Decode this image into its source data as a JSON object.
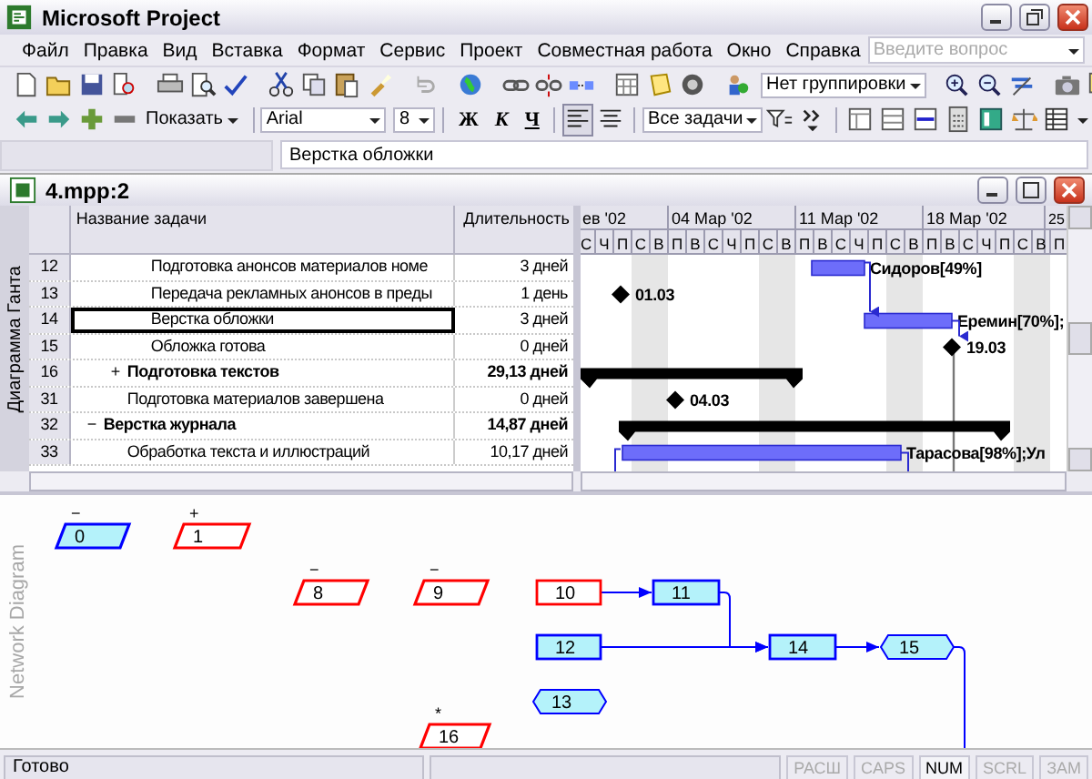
{
  "window": {
    "title": "Microsoft Project"
  },
  "menu": [
    {
      "label": "Файл"
    },
    {
      "label": "Правка"
    },
    {
      "label": "Вид"
    },
    {
      "label": "Вставка"
    },
    {
      "label": "Формат"
    },
    {
      "label": "Сервис"
    },
    {
      "label": "Проект"
    },
    {
      "label": "Совместная работа"
    },
    {
      "label": "Окно"
    },
    {
      "label": "Справка"
    }
  ],
  "help_box": {
    "placeholder": "Введите вопрос"
  },
  "toolbar_standard": {
    "grouping": "Нет группировки"
  },
  "toolbar_formatting": {
    "show_button": "Показать",
    "font": "Arial",
    "font_size": "8",
    "style_buttons": [
      {
        "label": "Ж",
        "kind": "bold"
      },
      {
        "label": "К",
        "kind": "italic"
      },
      {
        "label": "Ч",
        "kind": "underline"
      }
    ],
    "align_buttons": [
      {
        "kind": "left",
        "pressed": true
      },
      {
        "kind": "center",
        "pressed": false
      }
    ],
    "filter": "Все задачи"
  },
  "entry_bar": {
    "value": "Верстка обложки"
  },
  "document_window": {
    "title": "4.mpp:2"
  },
  "gantt": {
    "view_label": "Диаграмма Ганта",
    "columns": [
      "Название задачи",
      "Длительность"
    ],
    "timescale": {
      "weeks": [
        "ев '02",
        "04 Мар '02",
        "11 Мар '02",
        "18 Мар '02",
        "25"
      ],
      "days": [
        "С",
        "Ч",
        "П",
        "С",
        "В",
        "П",
        "В",
        "С",
        "Ч",
        "П",
        "С",
        "В",
        "П",
        "В",
        "С",
        "Ч",
        "П",
        "С",
        "В",
        "П",
        "В",
        "С",
        "Ч",
        "П",
        "С",
        "В",
        "П"
      ]
    },
    "rows": [
      {
        "children": [
          {
            "children": [
              {
                "id": "12",
                "name": "Подготовка анонсов материалов номе",
                "duration": "3 дней",
                "kind": "task",
                "selected": false,
                "bar_label": "Сидоров[49%]"
              },
              {
                "id": "13",
                "name": "Передача рекламных анонсов в преды",
                "duration": "1 день",
                "kind": "milestone",
                "selected": false,
                "bar_label": "01.03"
              },
              {
                "id": "14",
                "name": "Верстка обложки",
                "duration": "3 дней",
                "kind": "task",
                "selected": true,
                "bar_label": "Еремин[70%];"
              },
              {
                "id": "15",
                "name": "Обложка готова",
                "duration": "0 дней",
                "kind": "milestone",
                "selected": false,
                "bar_label": "19.03"
              }
            ]
          },
          {
            "id": "16",
            "name": "Подготовка текстов",
            "duration": "29,13 дней",
            "kind": "summary",
            "outline_symbol": "+",
            "selected": false
          },
          {
            "id": "31",
            "name": "Подготовка материалов завершена",
            "duration": "0 дней",
            "kind": "milestone",
            "selected": false,
            "bar_label": "04.03"
          }
        ]
      },
      {
        "id": "32",
        "name": "Верстка журнала",
        "duration": "14,87 дней",
        "kind": "summary",
        "outline_symbol": "−",
        "selected": false,
        "children": [
          {
            "id": "33",
            "name": "Обработка текста и иллюстраций",
            "duration": "10,17 дней",
            "kind": "task",
            "selected": false,
            "bar_label": "Тарасова[98%];Ул"
          }
        ]
      }
    ]
  },
  "network": {
    "view_label": "Network Diagram",
    "nodes": [
      {
        "label": "0",
        "kind": "summary",
        "critical": false,
        "in_progress": true,
        "symbol": "−"
      },
      {
        "label": "1",
        "kind": "summary",
        "critical": true,
        "in_progress": false,
        "symbol": "+"
      },
      {
        "label": "8",
        "kind": "summary",
        "critical": true,
        "in_progress": false,
        "symbol": "−"
      },
      {
        "label": "9",
        "kind": "summary",
        "critical": true,
        "in_progress": false,
        "symbol": "−"
      },
      {
        "label": "10",
        "kind": "task",
        "critical": true,
        "in_progress": false
      },
      {
        "label": "11",
        "kind": "task",
        "critical": false,
        "in_progress": true
      },
      {
        "label": "12",
        "kind": "task",
        "critical": false,
        "in_progress": true
      },
      {
        "label": "14",
        "kind": "task",
        "critical": false,
        "in_progress": true
      },
      {
        "label": "15",
        "kind": "milestone",
        "critical": false,
        "in_progress": true
      },
      {
        "label": "13",
        "kind": "milestone",
        "critical": false,
        "in_progress": true
      },
      {
        "label": "16",
        "kind": "summary",
        "critical": true,
        "in_progress": false,
        "symbol": "*"
      }
    ]
  },
  "status_bar": {
    "text": "Готово",
    "indicators": [
      {
        "label": "РАСШ",
        "on": false
      },
      {
        "label": "CAPS",
        "on": false
      },
      {
        "label": "NUM",
        "on": true
      },
      {
        "label": "SCRL",
        "on": false
      },
      {
        "label": "ЗАМ",
        "on": false
      }
    ]
  }
}
